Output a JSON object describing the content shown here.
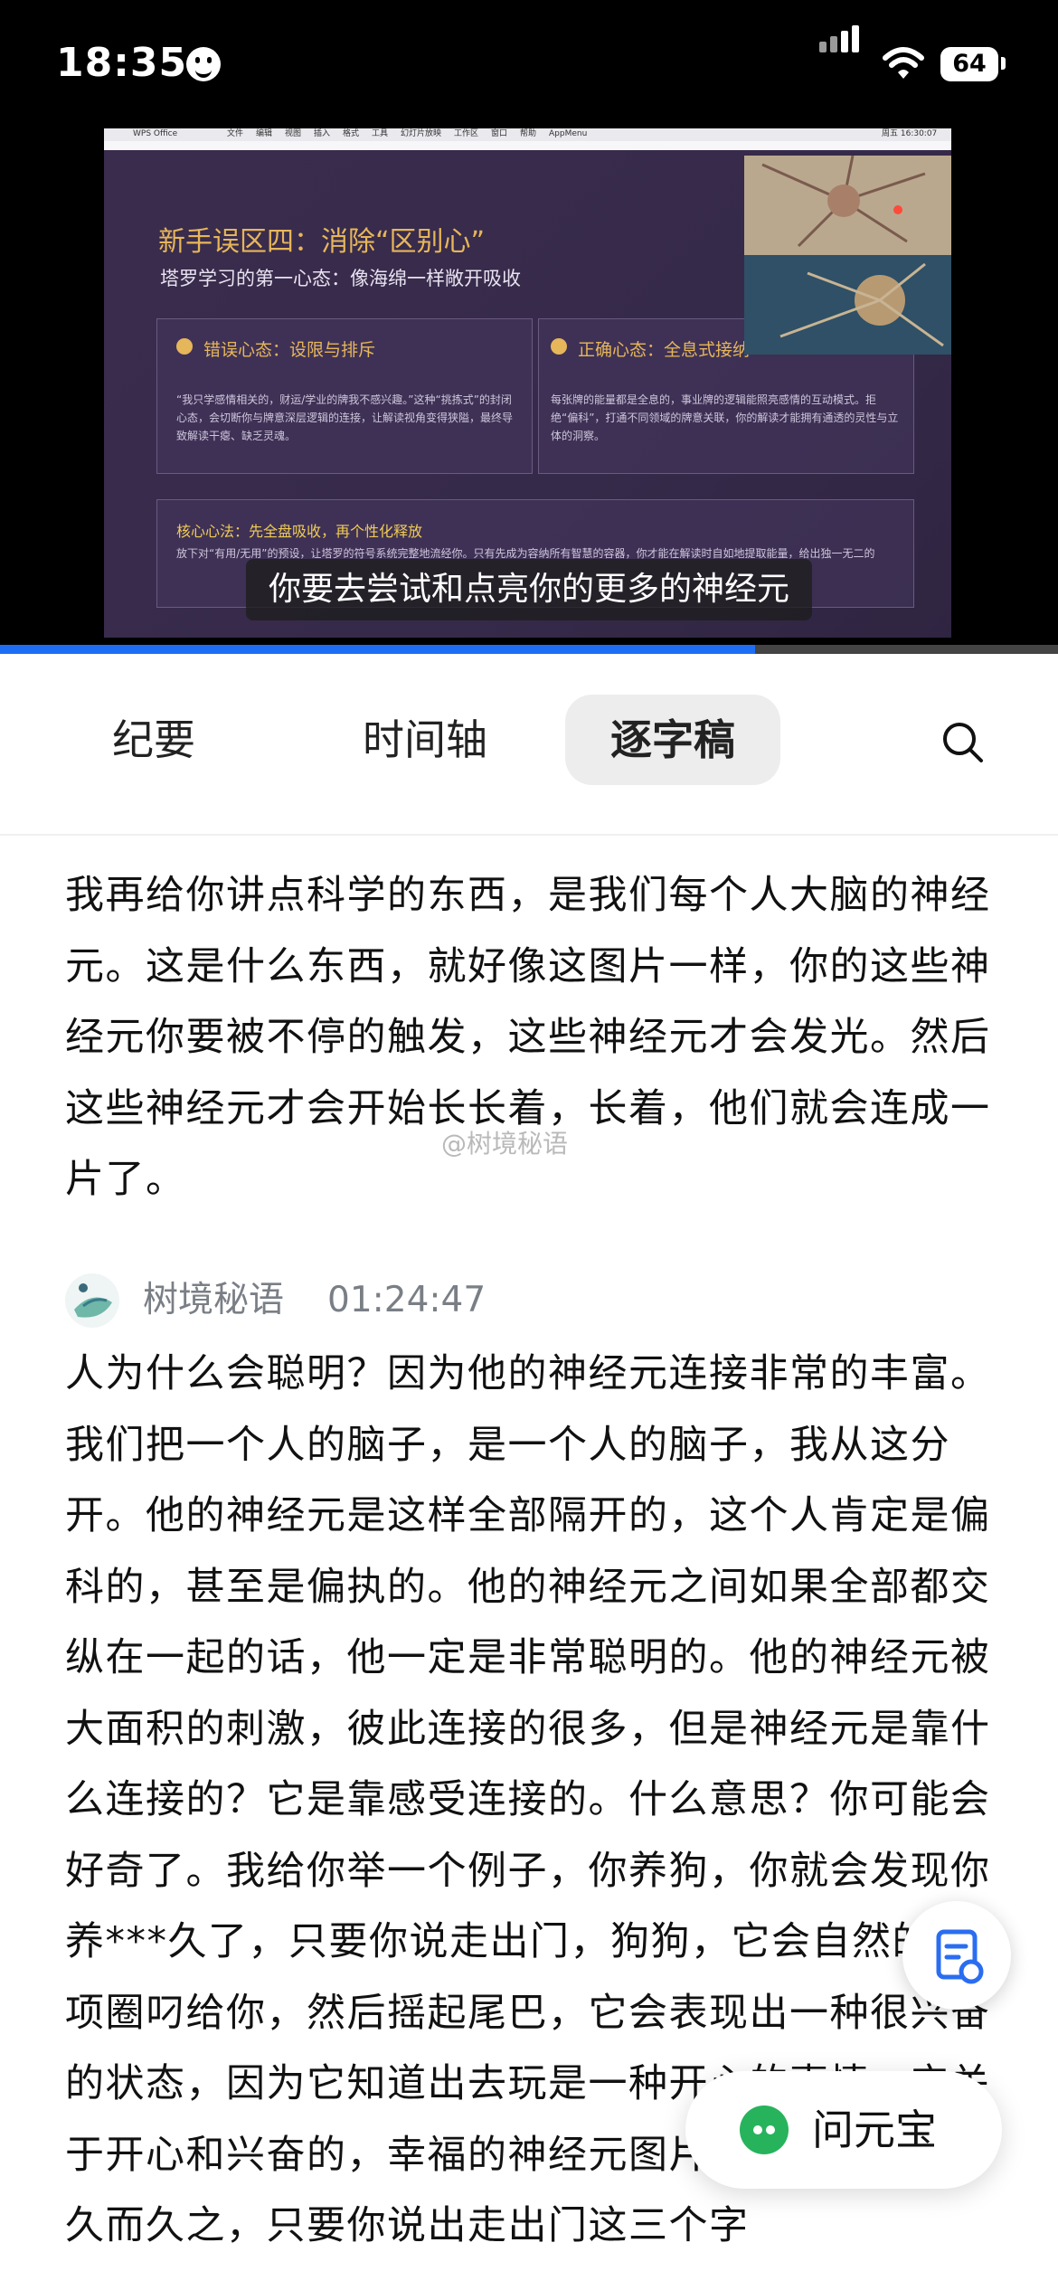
{
  "status_bar": {
    "time": "18:35",
    "battery": "64"
  },
  "video": {
    "menu_bar": [
      "WPS Office",
      "文件",
      "编辑",
      "视图",
      "插入",
      "格式",
      "工具",
      "幻灯片放映",
      "工作区",
      "窗口",
      "帮助",
      "AppMenu"
    ],
    "menu_right": "周五 16:30:07",
    "slide_title": "新手误区四：消除“区别心”",
    "slide_subtitle": "塔罗学习的第一心态：像海绵一样敞开吸收",
    "wrong_title": "错误心态：设限与排斥",
    "wrong_body": "“我只学感情相关的，财运/学业的牌我不感兴趣。”这种“挑拣式”的封闭心态，会切断你与牌意深层逻辑的连接，让解读视角变得狭隘，最终导致解读干瘪、缺乏灵魂。",
    "right_title": "正确心态：全息式接纳",
    "right_body": "每张牌的能量都是全息的，事业牌的逻辑能照亮感情的互动模式。拒绝“偏科”，打通不同领域的牌意关联，你的解读才能拥有通透的灵性与立体的洞察。",
    "core_title": "核心心法：先全盘吸收，再个性化释放",
    "core_body": "放下对“有用/无用”的预设，让塔罗的符号系统完整地流经你。只有先成为容纳所有智慧的容器，你才能在解读时自如地提取能量，给出独一无二的",
    "caption": "你要去尝试和点亮你的更多的神经元",
    "progress": 0.714
  },
  "tabs": {
    "summary": "纪要",
    "timeline": "时间轴",
    "transcript": "逐字稿"
  },
  "transcript": {
    "para1": "我再给你讲点科学的东西，是我们每个人大脑的神经元。这是什么东西，就好像这图片一样，你的这些神经元你要被不停的触发，这些神经元才会发光。然后这些神经元才会开始长长着，长着，他们就会连成一片了。",
    "watermark": "@树境秘语",
    "speaker_name": "树境秘语",
    "speaker_time": "01:24:47",
    "para2": "人为什么会聪明？因为他的神经元连接非常的丰富。我们把一个人的脑子，是一个人的脑子，我从这分开。他的神经元是这样全部隔开的，这个人肯定是偏科的，甚至是偏执的。他的神经元之间如果全部都交纵在一起的话，他一定是非常聪明的。他的神经元被大面积的刺激，彼此连接的很多，但是神经元是靠什么连接的？它是靠感受连接的。什么意思？你可能会好奇了。我给你举一个例子，你养狗，你就会发现你养***久了，只要你说走出门，狗狗，它会自然的把项圈叼给你，然后摇起尾巴，它会表现出一种很兴奋的状态，因为它知道出去玩是一种开心的事情，它关于开心和兴奋的，幸福的神经元图片一样被点亮了。久而久之，只要你说出走出门这三个字"
  },
  "floating": {
    "assistant_label": "问元宝"
  },
  "colors": {
    "accent_blue": "#1e6ef5",
    "slide_gold": "#e6b65a",
    "yuanbao_green": "#27b35c"
  }
}
